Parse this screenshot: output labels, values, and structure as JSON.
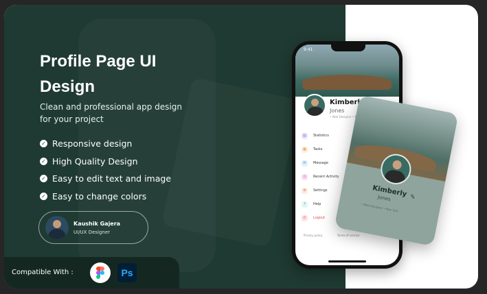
{
  "headline": {
    "line1": "Profile Page UI",
    "line2": "Design"
  },
  "subtitle": {
    "line1": "Clean and professional app design",
    "line2": "for your project"
  },
  "features": [
    "Responsive design",
    "High Quality Design",
    "Easy to edit text and image",
    "Easy to change colors"
  ],
  "author": {
    "name": "Kaushik Gajera",
    "role": "UI/UX Designer"
  },
  "compatible": {
    "label": "Compatible With :",
    "ps_label": "Ps"
  },
  "phone": {
    "status_time": "9:41",
    "first_name": "Kimberly",
    "last_name": "Jones",
    "meta": "• Web Designer  • New York",
    "menu": [
      "Statistics",
      "Tasks",
      "Message",
      "Recent Activity",
      "Settings",
      "Help",
      "Logout"
    ],
    "footer": [
      "Privacy policy",
      "Terms of service"
    ]
  },
  "float_card": {
    "first_name": "Kimberly",
    "last_name": "Jones",
    "meta": "• Web Designer    • New York"
  },
  "colors": {
    "panel": "#1f3a32",
    "panel_dark": "#142821",
    "logout": "#e14c4c",
    "figma": [
      "#f24e1e",
      "#ff7262",
      "#a259ff",
      "#1abcfe",
      "#0acf83"
    ],
    "photoshop": "#31a8ff"
  },
  "icons": {
    "check": "check-circle-icon",
    "edit": "edit-icon",
    "figma": "figma-logo-icon",
    "photoshop": "photoshop-logo-icon"
  }
}
